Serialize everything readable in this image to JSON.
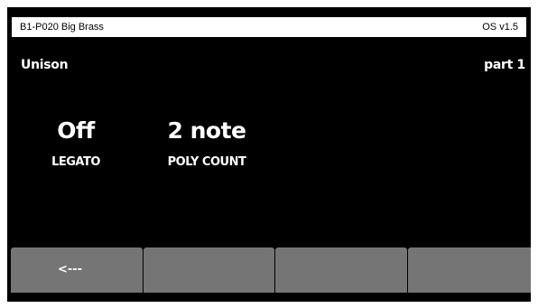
{
  "titlebar": {
    "patch_name": "B1-P020 Big Brass",
    "os_version": "OS v1.5"
  },
  "page": {
    "title": "Unison",
    "part": "part 1"
  },
  "params": [
    {
      "value": "Off",
      "label": "LEGATO"
    },
    {
      "value": "2 note",
      "label": "POLY COUNT"
    }
  ],
  "softkeys": [
    {
      "label": "<---"
    },
    {
      "label": ""
    },
    {
      "label": ""
    },
    {
      "label": ""
    }
  ],
  "colors": {
    "background": "#000000",
    "softkey": "#757575",
    "text": "#ffffff"
  }
}
